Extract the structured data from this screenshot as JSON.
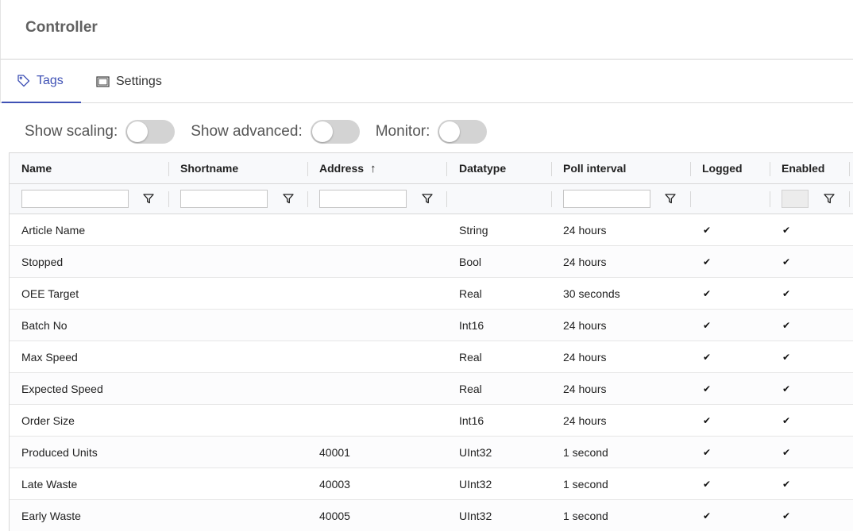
{
  "header": {
    "title": "Controller"
  },
  "tabs": [
    {
      "label": "Tags",
      "icon": "tag-icon",
      "active": true
    },
    {
      "label": "Settings",
      "icon": "window-icon",
      "active": false
    }
  ],
  "toggles": [
    {
      "label": "Show scaling:",
      "on": false
    },
    {
      "label": "Show advanced:",
      "on": false
    },
    {
      "label": "Monitor:",
      "on": false
    }
  ],
  "grid": {
    "columns": [
      "Name",
      "Shortname",
      "Address",
      "Datatype",
      "Poll interval",
      "Logged",
      "Enabled"
    ],
    "sort_arrow": "↑",
    "check_glyph": "✔",
    "rows": [
      {
        "name": "Article Name",
        "shortname": "",
        "address": "",
        "datatype": "String",
        "poll": "24 hours",
        "logged": true,
        "enabled": true
      },
      {
        "name": "Stopped",
        "shortname": "",
        "address": "",
        "datatype": "Bool",
        "poll": "24 hours",
        "logged": true,
        "enabled": true
      },
      {
        "name": "OEE Target",
        "shortname": "",
        "address": "",
        "datatype": "Real",
        "poll": "30 seconds",
        "logged": true,
        "enabled": true
      },
      {
        "name": "Batch No",
        "shortname": "",
        "address": "",
        "datatype": "Int16",
        "poll": "24 hours",
        "logged": true,
        "enabled": true
      },
      {
        "name": "Max Speed",
        "shortname": "",
        "address": "",
        "datatype": "Real",
        "poll": "24 hours",
        "logged": true,
        "enabled": true
      },
      {
        "name": "Expected Speed",
        "shortname": "",
        "address": "",
        "datatype": "Real",
        "poll": "24 hours",
        "logged": true,
        "enabled": true
      },
      {
        "name": "Order Size",
        "shortname": "",
        "address": "",
        "datatype": "Int16",
        "poll": "24 hours",
        "logged": true,
        "enabled": true
      },
      {
        "name": "Produced Units",
        "shortname": "",
        "address": "40001",
        "datatype": "UInt32",
        "poll": "1 second",
        "logged": true,
        "enabled": true
      },
      {
        "name": "Late Waste",
        "shortname": "",
        "address": "40003",
        "datatype": "UInt32",
        "poll": "1 second",
        "logged": true,
        "enabled": true
      },
      {
        "name": "Early Waste",
        "shortname": "",
        "address": "40005",
        "datatype": "UInt32",
        "poll": "1 second",
        "logged": true,
        "enabled": true
      }
    ]
  }
}
